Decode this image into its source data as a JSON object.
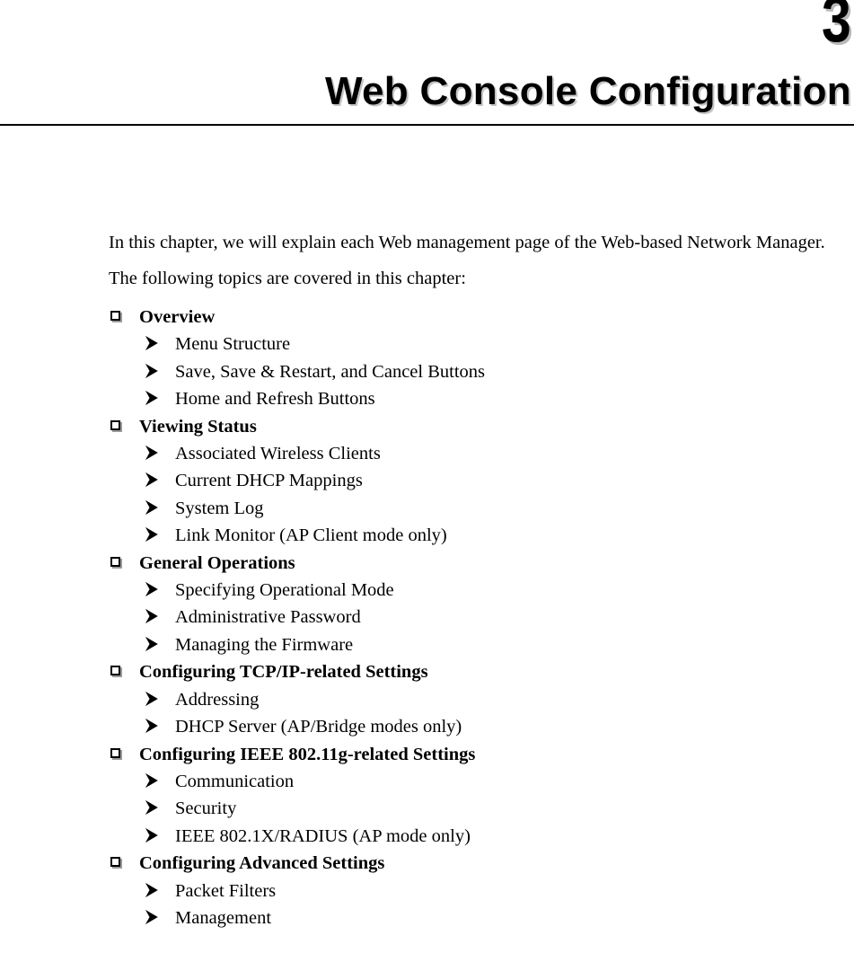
{
  "header": {
    "chapter_number": "3",
    "chapter_title": "Web Console Configuration"
  },
  "intro": {
    "line1": "In this chapter, we will explain each Web management page of the Web-based Network Manager.",
    "line2": "The following topics are covered in this chapter:"
  },
  "topics": [
    {
      "heading": "Overview",
      "items": [
        "Menu Structure",
        "Save, Save & Restart, and Cancel Buttons",
        "Home and Refresh Buttons"
      ]
    },
    {
      "heading": "Viewing Status",
      "items": [
        "Associated Wireless Clients",
        "Current DHCP Mappings",
        "System Log",
        "Link Monitor (AP Client mode only)"
      ]
    },
    {
      "heading": "General Operations",
      "items": [
        "Specifying Operational Mode",
        "Administrative Password",
        "Managing the Firmware"
      ]
    },
    {
      "heading": "Configuring TCP/IP-related Settings",
      "items": [
        "Addressing",
        "DHCP Server (AP/Bridge modes only)"
      ]
    },
    {
      "heading": "Configuring IEEE 802.11g-related Settings",
      "items": [
        "Communication",
        "Security",
        "IEEE 802.1X/RADIUS (AP mode only)"
      ]
    },
    {
      "heading": "Configuring Advanced Settings",
      "items": [
        "Packet Filters",
        "Management"
      ]
    }
  ],
  "icons": {
    "bullet_square": "hollow-square-bullet",
    "bullet_arrow": "arrowhead-bullet"
  },
  "colors": {
    "text": "#000000",
    "page_background": "#ffffff",
    "shadow": "#b9b9b9",
    "rule": "#000000"
  }
}
